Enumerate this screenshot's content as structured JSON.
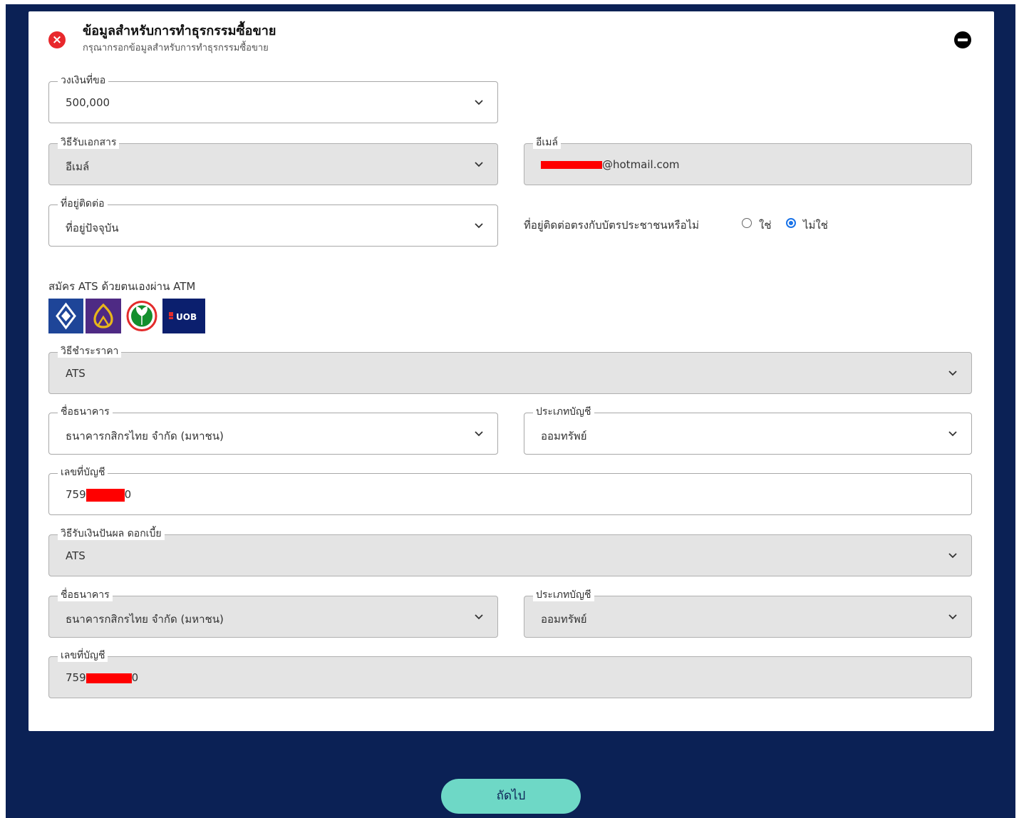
{
  "header": {
    "title": "ข้อมูลสำหรับการทำธุรกรรมซื้อขาย",
    "subtitle": "กรุณากรอกข้อมูลสำหรับการทำธุรกรรมซื้อขาย"
  },
  "credit_limit": {
    "label": "วงเงินที่ขอ",
    "value": "500,000"
  },
  "doc_method": {
    "label": "วิธีรับเอกสาร",
    "value": "อีเมล์"
  },
  "email": {
    "label": "อีเมล์",
    "value_suffix": "@hotmail.com"
  },
  "contact_address": {
    "label": "ที่อยู่ติดต่อ",
    "value": "ที่อยู่ปัจจุบัน"
  },
  "address_match": {
    "question": "ที่อยู่ติดต่อตรงกับบัตรประชาชนหรือไม่",
    "options": [
      "ใช่",
      "ไม่ใช่"
    ],
    "selected": "ไม่ใช่"
  },
  "ats": {
    "label": "สมัคร ATS ด้วยตนเองผ่าน ATM",
    "banks": [
      {
        "icon": "bbl-logo-icon",
        "color": "#1e4598"
      },
      {
        "icon": "scb-logo-icon",
        "color": "#4e2a84"
      },
      {
        "icon": "kbank-logo-icon",
        "color": "#138f2d"
      },
      {
        "icon": "uob-logo-icon",
        "color": "#0b1f6e",
        "text": "UOB"
      }
    ]
  },
  "payment": {
    "method_label": "วิธีชำระราคา",
    "method_value": "ATS",
    "bank_label": "ชื่อธนาคาร",
    "bank_value": "ธนาคารกสิกรไทย จำกัด (มหาชน)",
    "account_type_label": "ประเภทบัญชี",
    "account_type_value": "ออมทรัพย์",
    "account_no_label": "เลขที่บัญชี",
    "account_no_prefix": "759",
    "account_no_suffix": "0"
  },
  "dividend": {
    "method_label": "วิธีรับเงินปันผล ดอกเบี้ย",
    "method_value": "ATS",
    "bank_label": "ชื่อธนาคาร",
    "bank_value": "ธนาคารกสิกรไทย จำกัด (มหาชน)",
    "account_type_label": "ประเภทบัญชี",
    "account_type_value": "ออมทรัพย์",
    "account_no_label": "เลขที่บัญชี",
    "account_no_prefix": "759",
    "account_no_suffix": "0"
  },
  "next_button": "ถัดไป",
  "colors": {
    "background": "#0b2155",
    "accent_button": "#6ed8c6",
    "error_icon": "#e8282c",
    "radio_selected": "#1a73e8",
    "disabled_field": "#e4e4e4"
  }
}
